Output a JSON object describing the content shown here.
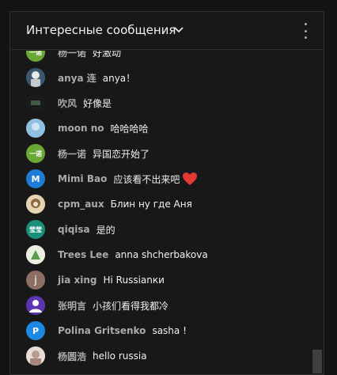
{
  "header": {
    "title": "Интересные сообщения"
  },
  "messages": [
    {
      "author": "杨一诺",
      "text": "好激动"
    },
    {
      "author": "anya 连",
      "text": "anya！"
    },
    {
      "author": "吹风",
      "text": "好像是"
    },
    {
      "author": "moon no",
      "text": "哈哈哈哈"
    },
    {
      "author": "杨一诺",
      "text": "异国恋开始了"
    },
    {
      "author": "Mimi Bao",
      "text": "应该看不出来吧"
    },
    {
      "author": "cpm_aux",
      "text": "Блин ну где Аня"
    },
    {
      "author": "qiqisa",
      "text": "是的"
    },
    {
      "author": "Trees Lee",
      "text": "anna shcherbakova"
    },
    {
      "author": "jia xing",
      "text": "Hi Russianки"
    },
    {
      "author": "张明言",
      "text": "小孩们看得我都冷"
    },
    {
      "author": "Polina Gritsenko",
      "text": "sasha !"
    },
    {
      "author": "杨圆浩",
      "text": "hello russia"
    }
  ],
  "avatars": {
    "a0": "一诺",
    "a4": "一诺",
    "a5": "M",
    "a7": "莹莹",
    "a9": "j",
    "a11": "P"
  },
  "colors": {
    "accent_green": "#6aa836",
    "mimi_blue": "#1c7cd6",
    "qiqisa_teal": "#1a8f7a",
    "jia_brown": "#8d6e63",
    "zhang_purple": "#5e35b1",
    "polina_blue": "#1e88e5",
    "heart": "#e53935"
  }
}
